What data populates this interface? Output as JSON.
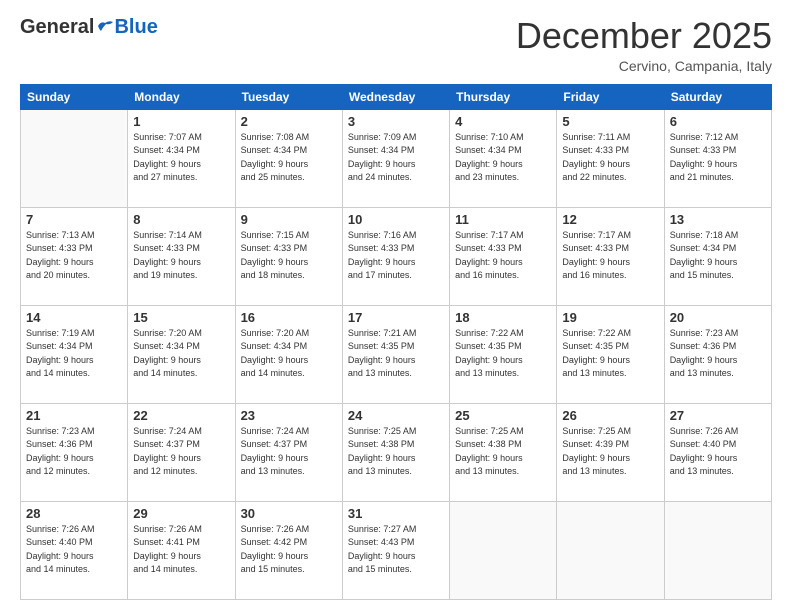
{
  "header": {
    "logo_general": "General",
    "logo_blue": "Blue",
    "month_title": "December 2025",
    "location": "Cervino, Campania, Italy"
  },
  "calendar": {
    "days_of_week": [
      "Sunday",
      "Monday",
      "Tuesday",
      "Wednesday",
      "Thursday",
      "Friday",
      "Saturday"
    ],
    "weeks": [
      [
        {
          "day": "",
          "info": ""
        },
        {
          "day": "1",
          "info": "Sunrise: 7:07 AM\nSunset: 4:34 PM\nDaylight: 9 hours\nand 27 minutes."
        },
        {
          "day": "2",
          "info": "Sunrise: 7:08 AM\nSunset: 4:34 PM\nDaylight: 9 hours\nand 25 minutes."
        },
        {
          "day": "3",
          "info": "Sunrise: 7:09 AM\nSunset: 4:34 PM\nDaylight: 9 hours\nand 24 minutes."
        },
        {
          "day": "4",
          "info": "Sunrise: 7:10 AM\nSunset: 4:34 PM\nDaylight: 9 hours\nand 23 minutes."
        },
        {
          "day": "5",
          "info": "Sunrise: 7:11 AM\nSunset: 4:33 PM\nDaylight: 9 hours\nand 22 minutes."
        },
        {
          "day": "6",
          "info": "Sunrise: 7:12 AM\nSunset: 4:33 PM\nDaylight: 9 hours\nand 21 minutes."
        }
      ],
      [
        {
          "day": "7",
          "info": "Sunrise: 7:13 AM\nSunset: 4:33 PM\nDaylight: 9 hours\nand 20 minutes."
        },
        {
          "day": "8",
          "info": "Sunrise: 7:14 AM\nSunset: 4:33 PM\nDaylight: 9 hours\nand 19 minutes."
        },
        {
          "day": "9",
          "info": "Sunrise: 7:15 AM\nSunset: 4:33 PM\nDaylight: 9 hours\nand 18 minutes."
        },
        {
          "day": "10",
          "info": "Sunrise: 7:16 AM\nSunset: 4:33 PM\nDaylight: 9 hours\nand 17 minutes."
        },
        {
          "day": "11",
          "info": "Sunrise: 7:17 AM\nSunset: 4:33 PM\nDaylight: 9 hours\nand 16 minutes."
        },
        {
          "day": "12",
          "info": "Sunrise: 7:17 AM\nSunset: 4:33 PM\nDaylight: 9 hours\nand 16 minutes."
        },
        {
          "day": "13",
          "info": "Sunrise: 7:18 AM\nSunset: 4:34 PM\nDaylight: 9 hours\nand 15 minutes."
        }
      ],
      [
        {
          "day": "14",
          "info": "Sunrise: 7:19 AM\nSunset: 4:34 PM\nDaylight: 9 hours\nand 14 minutes."
        },
        {
          "day": "15",
          "info": "Sunrise: 7:20 AM\nSunset: 4:34 PM\nDaylight: 9 hours\nand 14 minutes."
        },
        {
          "day": "16",
          "info": "Sunrise: 7:20 AM\nSunset: 4:34 PM\nDaylight: 9 hours\nand 14 minutes."
        },
        {
          "day": "17",
          "info": "Sunrise: 7:21 AM\nSunset: 4:35 PM\nDaylight: 9 hours\nand 13 minutes."
        },
        {
          "day": "18",
          "info": "Sunrise: 7:22 AM\nSunset: 4:35 PM\nDaylight: 9 hours\nand 13 minutes."
        },
        {
          "day": "19",
          "info": "Sunrise: 7:22 AM\nSunset: 4:35 PM\nDaylight: 9 hours\nand 13 minutes."
        },
        {
          "day": "20",
          "info": "Sunrise: 7:23 AM\nSunset: 4:36 PM\nDaylight: 9 hours\nand 13 minutes."
        }
      ],
      [
        {
          "day": "21",
          "info": "Sunrise: 7:23 AM\nSunset: 4:36 PM\nDaylight: 9 hours\nand 12 minutes."
        },
        {
          "day": "22",
          "info": "Sunrise: 7:24 AM\nSunset: 4:37 PM\nDaylight: 9 hours\nand 12 minutes."
        },
        {
          "day": "23",
          "info": "Sunrise: 7:24 AM\nSunset: 4:37 PM\nDaylight: 9 hours\nand 13 minutes."
        },
        {
          "day": "24",
          "info": "Sunrise: 7:25 AM\nSunset: 4:38 PM\nDaylight: 9 hours\nand 13 minutes."
        },
        {
          "day": "25",
          "info": "Sunrise: 7:25 AM\nSunset: 4:38 PM\nDaylight: 9 hours\nand 13 minutes."
        },
        {
          "day": "26",
          "info": "Sunrise: 7:25 AM\nSunset: 4:39 PM\nDaylight: 9 hours\nand 13 minutes."
        },
        {
          "day": "27",
          "info": "Sunrise: 7:26 AM\nSunset: 4:40 PM\nDaylight: 9 hours\nand 13 minutes."
        }
      ],
      [
        {
          "day": "28",
          "info": "Sunrise: 7:26 AM\nSunset: 4:40 PM\nDaylight: 9 hours\nand 14 minutes."
        },
        {
          "day": "29",
          "info": "Sunrise: 7:26 AM\nSunset: 4:41 PM\nDaylight: 9 hours\nand 14 minutes."
        },
        {
          "day": "30",
          "info": "Sunrise: 7:26 AM\nSunset: 4:42 PM\nDaylight: 9 hours\nand 15 minutes."
        },
        {
          "day": "31",
          "info": "Sunrise: 7:27 AM\nSunset: 4:43 PM\nDaylight: 9 hours\nand 15 minutes."
        },
        {
          "day": "",
          "info": ""
        },
        {
          "day": "",
          "info": ""
        },
        {
          "day": "",
          "info": ""
        }
      ]
    ]
  }
}
